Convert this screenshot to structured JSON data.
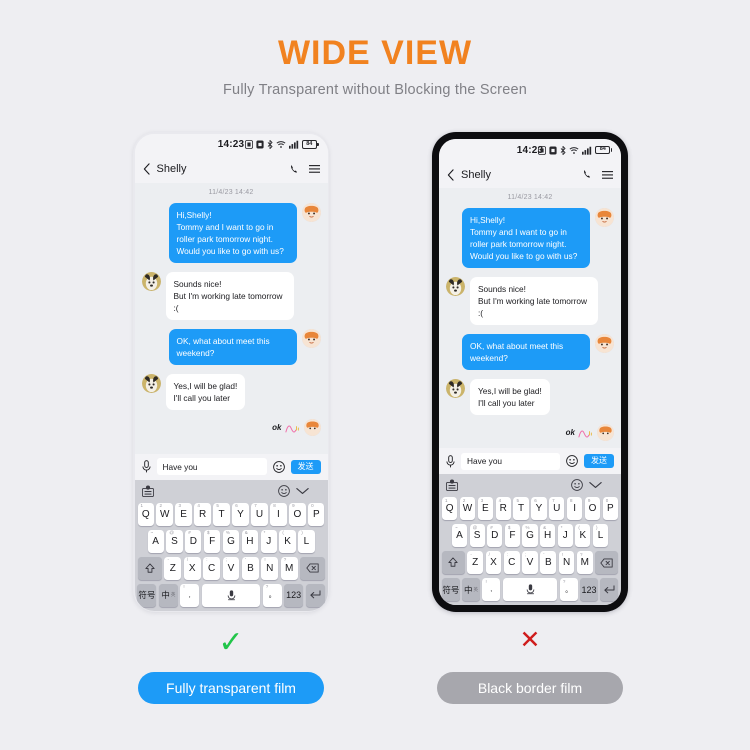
{
  "hero": {
    "title": "WIDE VIEW",
    "subtitle": "Fully Transparent without Blocking the Screen",
    "title_color": "#f18220",
    "subtitle_color": "#808086",
    "background": "#eeeef2"
  },
  "phone": {
    "statusbar": {
      "time": "14:23",
      "battery_level": "84",
      "icons": [
        "app-icon",
        "mute-icon",
        "bluetooth-icon",
        "wifi-icon",
        "signal-icon",
        "battery-icon"
      ]
    },
    "chat_header": {
      "back": "chevron-left-icon",
      "contact_name": "Shelly",
      "call": "phone-icon",
      "menu": "hamburger-menu-icon"
    },
    "conversation": {
      "timestamp": "11/4/23 14:42",
      "messages": [
        {
          "side": "out",
          "text": "Hi,Shelly!\nTommy and I want to go in roller park tomorrow night. Would you like to go with us?"
        },
        {
          "side": "in",
          "text": "Sounds nice!\nBut I'm working late tomorrow :("
        },
        {
          "side": "out",
          "text": "OK, what about meet this weekend?"
        },
        {
          "side": "in",
          "text": "Yes,I will be glad!\nI'll call you later"
        }
      ],
      "sticker_label": "ok"
    },
    "input_bar": {
      "mic": "microphone-icon",
      "text_value": "Have you",
      "placeholder": "Have you",
      "emoji": "emoji-smile-icon",
      "send_label": "发送"
    },
    "keyboard": {
      "toolbar": {
        "left_icon": "keyboard-settings-icon",
        "emoji_icon": "emoji-smile-icon",
        "collapse_icon": "chevron-down-icon"
      },
      "row1": [
        {
          "key": "Q",
          "sup": "1"
        },
        {
          "key": "W",
          "sup": "2"
        },
        {
          "key": "E",
          "sup": "3"
        },
        {
          "key": "R",
          "sup": "4"
        },
        {
          "key": "T",
          "sup": "5"
        },
        {
          "key": "Y",
          "sup": "6"
        },
        {
          "key": "U",
          "sup": "7"
        },
        {
          "key": "I",
          "sup": "8"
        },
        {
          "key": "O",
          "sup": "9"
        },
        {
          "key": "P",
          "sup": "0"
        }
      ],
      "row2": [
        {
          "key": "A",
          "sup": "~"
        },
        {
          "key": "S",
          "sup": "@"
        },
        {
          "key": "D",
          "sup": "#"
        },
        {
          "key": "F",
          "sup": "$"
        },
        {
          "key": "G",
          "sup": "%"
        },
        {
          "key": "H",
          "sup": "&"
        },
        {
          "key": "J",
          "sup": "*"
        },
        {
          "key": "K",
          "sup": "("
        },
        {
          "key": "L",
          "sup": ")"
        }
      ],
      "row3": [
        {
          "key": "Z",
          "sup": "-"
        },
        {
          "key": "X",
          "sup": "/"
        },
        {
          "key": "C",
          "sup": ":"
        },
        {
          "key": "V",
          "sup": ";"
        },
        {
          "key": "B",
          "sup": "'"
        },
        {
          "key": "N",
          "sup": "!"
        },
        {
          "key": "M",
          "sup": "?"
        }
      ],
      "shift": "shift-icon",
      "backspace": "backspace-icon",
      "symbols_key": "符号",
      "lang_key": "中",
      "lang_sub": "英",
      "comma_key": ",",
      "comma_sup": "!",
      "space_key": "space-mic-icon",
      "period_key": "。",
      "period_sup": "?",
      "number_key": "123",
      "enter_key": "enter-icon"
    }
  },
  "comparison": {
    "left": {
      "mark": "✓",
      "mark_color": "#21c54a",
      "label": "Fully transparent film",
      "pill_color": "#1d9bf7"
    },
    "right": {
      "mark": "✕",
      "mark_color": "#cf1c1c",
      "label": "Black border film",
      "pill_color": "#a7a7ad"
    }
  }
}
